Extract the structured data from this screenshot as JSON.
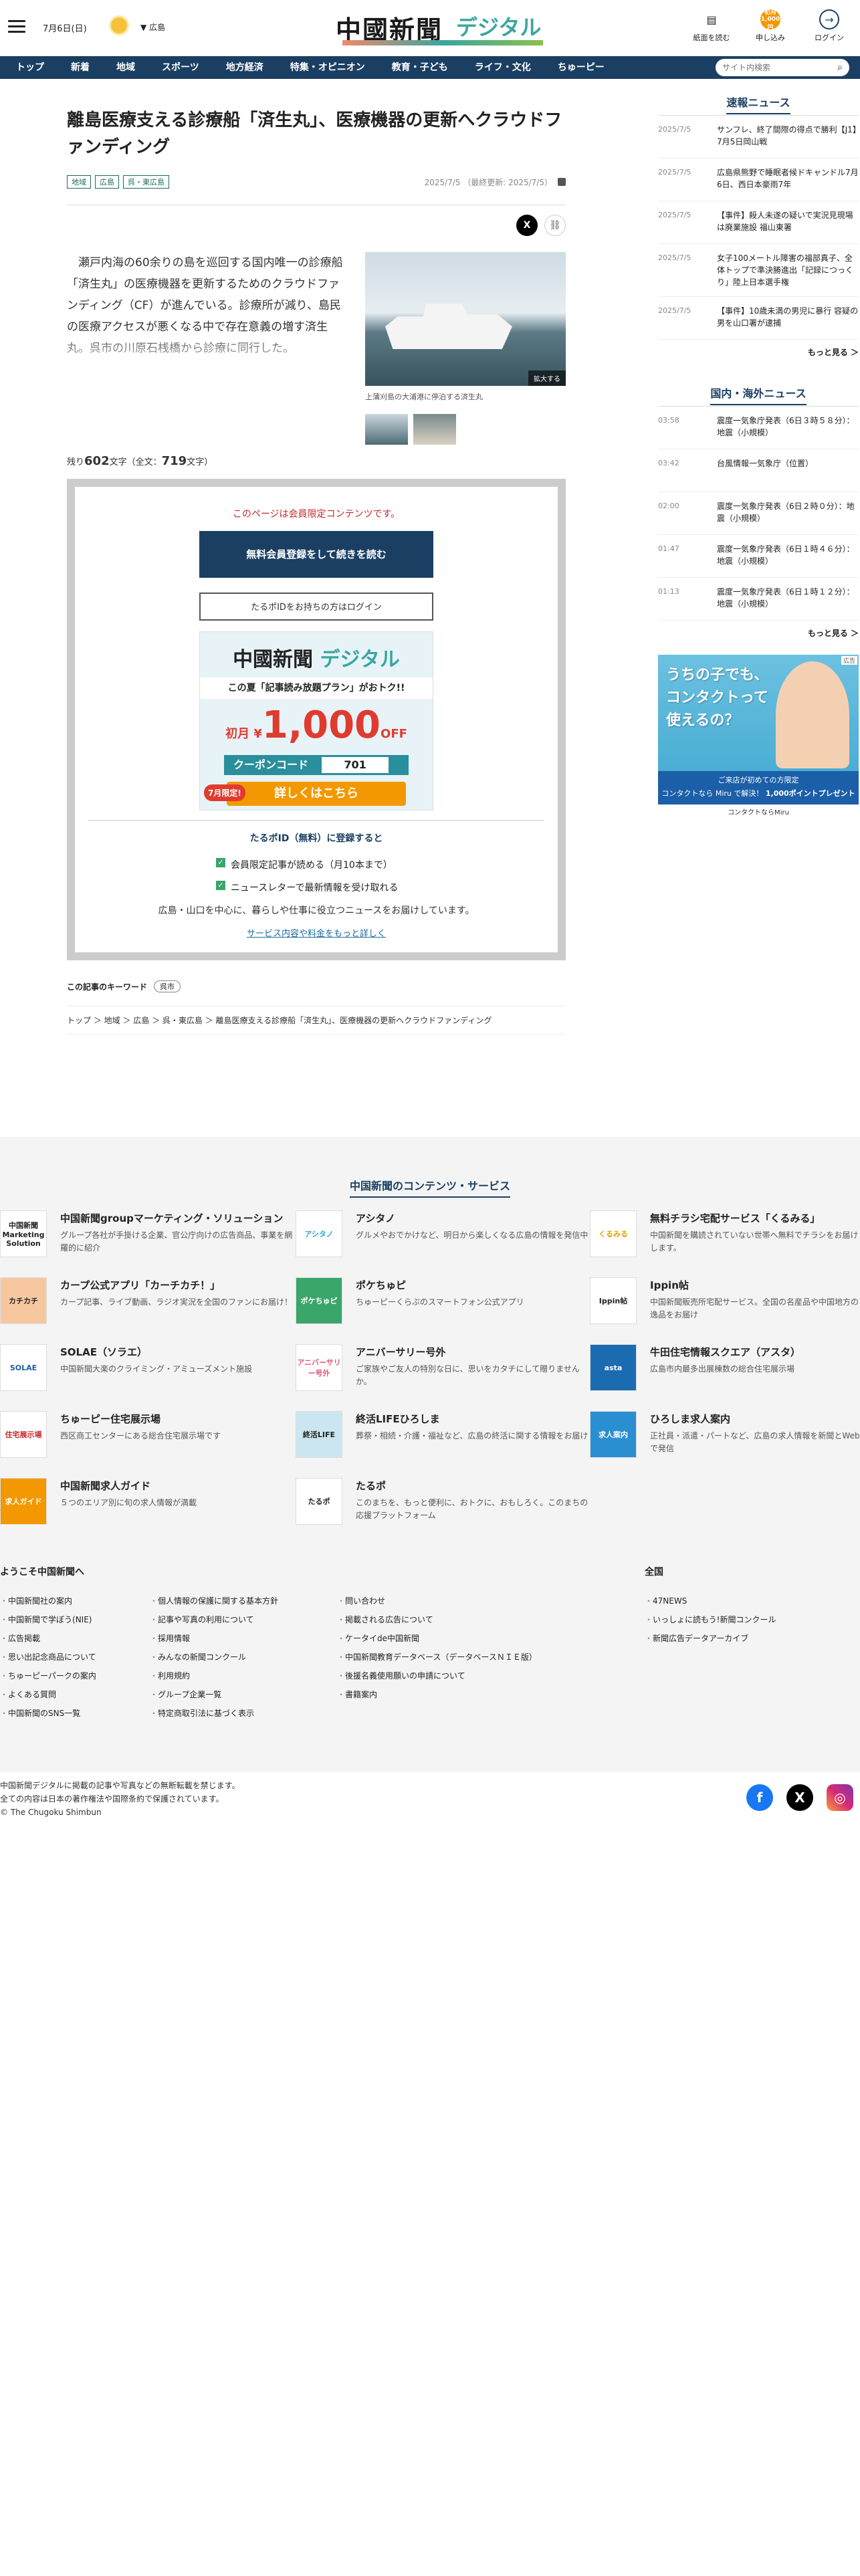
{
  "header": {
    "date": "7月6日(日)",
    "region": "広島",
    "logo_main": "中國新聞",
    "logo_sub": "デジタル",
    "icons": [
      {
        "label": "紙面を読む",
        "icon": "newspaper-icon"
      },
      {
        "label": "申し込み",
        "icon": "apply-badge",
        "badge": "初月1,000円"
      },
      {
        "label": "ログイン",
        "icon": "login-icon"
      }
    ]
  },
  "nav": {
    "items": [
      "トップ",
      "新着",
      "地域",
      "スポーツ",
      "地方経済",
      "特集・オピニオン",
      "教育・子ども",
      "ライフ・文化",
      "ちゅーピー"
    ],
    "search_placeholder": "サイト内検索"
  },
  "article": {
    "title": "離島医療支える診療船「済生丸」、医療機器の更新へクラウドファンディング",
    "tags": [
      "地域",
      "広島",
      "呉・東広島"
    ],
    "published": "2025/7/5",
    "updated": "（最終更新: 2025/7/5）",
    "lead": "瀬戸内海の60余りの島を巡回する国内唯一の診療船「済生丸」の医療機器を更新するためのクラウドファンディング（CF）が進んでいる。診療所が減り、島民の医療アクセスが悪くなる中で存在意義の増す済生丸。呉市の川原石桟橋から診療に同行した。",
    "photo_enlarge": "拡大する",
    "photo_caption": "上蒲刈島の大浦港に停泊する済生丸",
    "remaining_prefix": "残り",
    "remaining_chars": "602",
    "remaining_suffix": "文字（全文：",
    "total_chars": "719",
    "total_suffix": "文字）"
  },
  "paywall": {
    "notice": "このページは会員限定コンテンツです。",
    "register_btn": "無料会員登録をして続きを読む",
    "login_btn": "たるポIDをお持ちの方はログイン",
    "promo": {
      "logo": "中國新聞",
      "logo_sub": "デジタル",
      "band": "この夏「記事読み放題プラン」がおトク!!",
      "price_prefix": "初月 ¥",
      "price": "1,000",
      "price_suffix": "OFF",
      "coupon_label": "クーポンコード",
      "coupon_code": "701",
      "limited": "7月限定!",
      "cta": "詳しくはこちら"
    },
    "benefits_title": "たるポID（無料）に登録すると",
    "benefits": [
      "会員限定記事が読める（月10本まで）",
      "ニュースレターで最新情報を受け取れる"
    ],
    "note": "広島・山口を中心に、暮らしや仕事に役立つニュースをお届けしています。",
    "more_link": "サービス内容や料金をもっと詳しく"
  },
  "keywords": {
    "label": "この記事のキーワード",
    "items": [
      "呉市"
    ]
  },
  "breadcrumb": "トップ ＞ 地域 ＞ 広島 ＞ 呉・東広島 ＞ 離島医療支える診療船「済生丸」、医療機器の更新へクラウドファンディング",
  "sidebar": {
    "breaking_title": "速報ニュース",
    "breaking": [
      {
        "date": "2025/7/5",
        "headline": "サンフレ、終了間際の得点で勝利【J1】7月5日岡山戦"
      },
      {
        "date": "2025/7/5",
        "headline": "広島県熊野で睡眠者候ドキャンドル7月6日、西日本豪雨7年"
      },
      {
        "date": "2025/7/5",
        "headline": "【事件】殺人未遂の疑いで実況見現場は廃業施設 福山東署"
      },
      {
        "date": "2025/7/5",
        "headline": "女子100メートル障害の福部真子、全体トップで準決勝進出「記録につっくり」陸上日本選手権"
      },
      {
        "date": "2025/7/5",
        "headline": "【事件】10歳未満の男児に暴行 容疑の男を山口署が逮捕"
      }
    ],
    "breaking_more": "もっと見る ＞",
    "national_title": "国内・海外ニュース",
    "national": [
      {
        "date": "03:58",
        "headline": "震度一気象庁発表（6日３時５８分）：地震（小規模）"
      },
      {
        "date": "03:42",
        "headline": "台風情報一気象庁（位置）"
      },
      {
        "date": "02:00",
        "headline": "震度一気象庁発表（6日２時０分）：地震（小規模）"
      },
      {
        "date": "01:47",
        "headline": "震度一気象庁発表（6日１時４６分）：地震（小規模）"
      },
      {
        "date": "01:13",
        "headline": "震度一気象庁発表（6日１時１２分）：地震（小規模）"
      }
    ],
    "national_more": "もっと見る ＞",
    "ad": {
      "headline": "うちの子でも、コンタクトって使えるの？",
      "bar1": "ご来店が初めての方限定",
      "bar2": "コンタクトなら Miru で解決！",
      "bar3": "1,000ポイントプレゼント",
      "footer": "コンタクトならMiru",
      "ad_badge": "広告"
    }
  },
  "footer": {
    "title": "中国新聞のコンテンツ・サービス",
    "services": [
      {
        "icon": "中国新聞 Marketing Solution",
        "name": "中国新聞groupマーケティング・ソリューション",
        "desc": "グループ各社が手掛ける企業、官公庁向けの広告商品、事業を網羅的に紹介"
      },
      {
        "icon": "アシタノ",
        "name": "アシタノ",
        "desc": "グルメやおでかけなど、明日から楽しくなる広島の情報を発信中"
      },
      {
        "icon": "くるみる",
        "name": "無料チラシ宅配サービス「くるみる」",
        "desc": "中国新聞を購読されていない世帯へ無料でチラシをお届けします。"
      },
      {
        "icon": "カチカチ",
        "name": "カープ公式アプリ「カーチカチ！」",
        "desc": "カープ記事、ライブ動画、ラジオ実況を全国のファンにお届け！"
      },
      {
        "icon": "ポケちゅピ",
        "name": "ポケちゅピ",
        "desc": "ちゅーピーくらぶのスマートフォン公式アプリ"
      },
      {
        "icon": "Ippin帖",
        "name": "Ippin帖",
        "desc": "中国新聞販売所宅配サービス。全国の名産品や中国地方の逸品をお届け"
      },
      {
        "icon": "SOLAE",
        "name": "SOLAE（ソラエ）",
        "desc": "中国新聞大楽のクライミング・アミューズメント施設"
      },
      {
        "icon": "アニバーサリー号外",
        "name": "アニバーサリー号外",
        "desc": "ご家族やご友人の特別な日に、思いをカタチにして贈りませんか。"
      },
      {
        "icon": "asta",
        "name": "牛田住宅情報スクエア（アスタ）",
        "desc": "広島市内最多出展棟数の総合住宅展示場"
      },
      {
        "icon": "住宅展示場",
        "name": "ちゅーピー住宅展示場",
        "desc": "西区商工センターにある総合住宅展示場です"
      },
      {
        "icon": "終活LIFE",
        "name": "終活LIFEひろしま",
        "desc": "葬祭・相続・介護・福祉など、広島の終活に関する情報をお届け"
      },
      {
        "icon": "求人案内",
        "name": "ひろしま求人案内",
        "desc": "正社員・派遣・パートなど、広島の求人情報を新聞とWebで発信"
      },
      {
        "icon": "求人ガイド",
        "name": "中国新聞求人ガイド",
        "desc": "５つのエリア別に旬の求人情報が満載"
      },
      {
        "icon": "たるポ",
        "name": "たるポ",
        "desc": "このまちを、もっと便利に、おトクに、おもしろく。このまちの応援プラットフォーム"
      }
    ],
    "welcome": "ようこそ中国新聞へ",
    "col1": [
      "中国新聞社の案内",
      "中国新聞で学ぼう(NIE)",
      "広告掲載",
      "思い出記念商品について",
      "ちゅーピーパークの案内",
      "よくある質問",
      "中国新聞のSNS一覧"
    ],
    "col2": [
      "個人情報の保護に関する基本方針",
      "記事や写真の利用について",
      "採用情報",
      "みんなの新聞コンクール",
      "利用規約",
      "グループ企業一覧",
      "特定商取引法に基づく表示"
    ],
    "col3": [
      "問い合わせ",
      "掲載される広告について",
      "ケータイde中国新聞",
      "中国新聞教育データベース（データベースＮＩＥ版）",
      "後援名義使用願いの申請について",
      "書籍案内"
    ],
    "national_head": "全国",
    "col4": [
      "47NEWS",
      "いっしょに読もう!新聞コンクール",
      "新聞広告データアーカイブ"
    ],
    "copy1": "中国新聞デジタルに掲載の記事や写真などの無断転載を禁じます。",
    "copy2": "全ての内容は日本の著作権法や国際条約で保護されています。",
    "copy3": "© The Chugoku Shimbun"
  },
  "colors": {
    "navy": "#1b3f63",
    "accent": "#3aa6a0",
    "orange": "#f39800",
    "red": "#c32a2a"
  }
}
